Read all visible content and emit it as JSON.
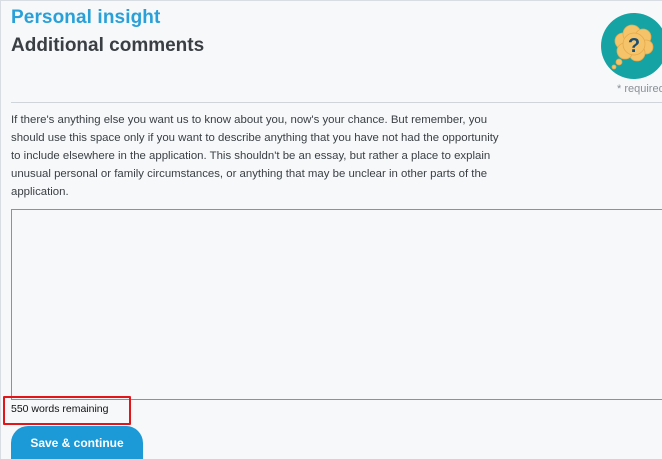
{
  "header": {
    "section_title": "Personal insight",
    "page_title": "Additional comments",
    "help_icon": "question-thought-bubble-icon",
    "required_note": "* required"
  },
  "intro": {
    "text": "If there's anything else you want us to know about you, now's your chance. But remember, you should use this space only if you want to describe anything that you have not had the opportunity to include elsewhere in the application. This shouldn't be an essay, but rather a place to explain unusual personal or family circumstances, or anything that may be unclear in other parts of the application."
  },
  "comments": {
    "value": "",
    "word_count_label": "550 words remaining"
  },
  "actions": {
    "save_label": "Save & continue"
  },
  "colors": {
    "accent": "#1c9ad8",
    "section_title": "#2aa0d8",
    "help_icon_bg": "#16a3a3",
    "highlight_box": "#e0161b"
  }
}
